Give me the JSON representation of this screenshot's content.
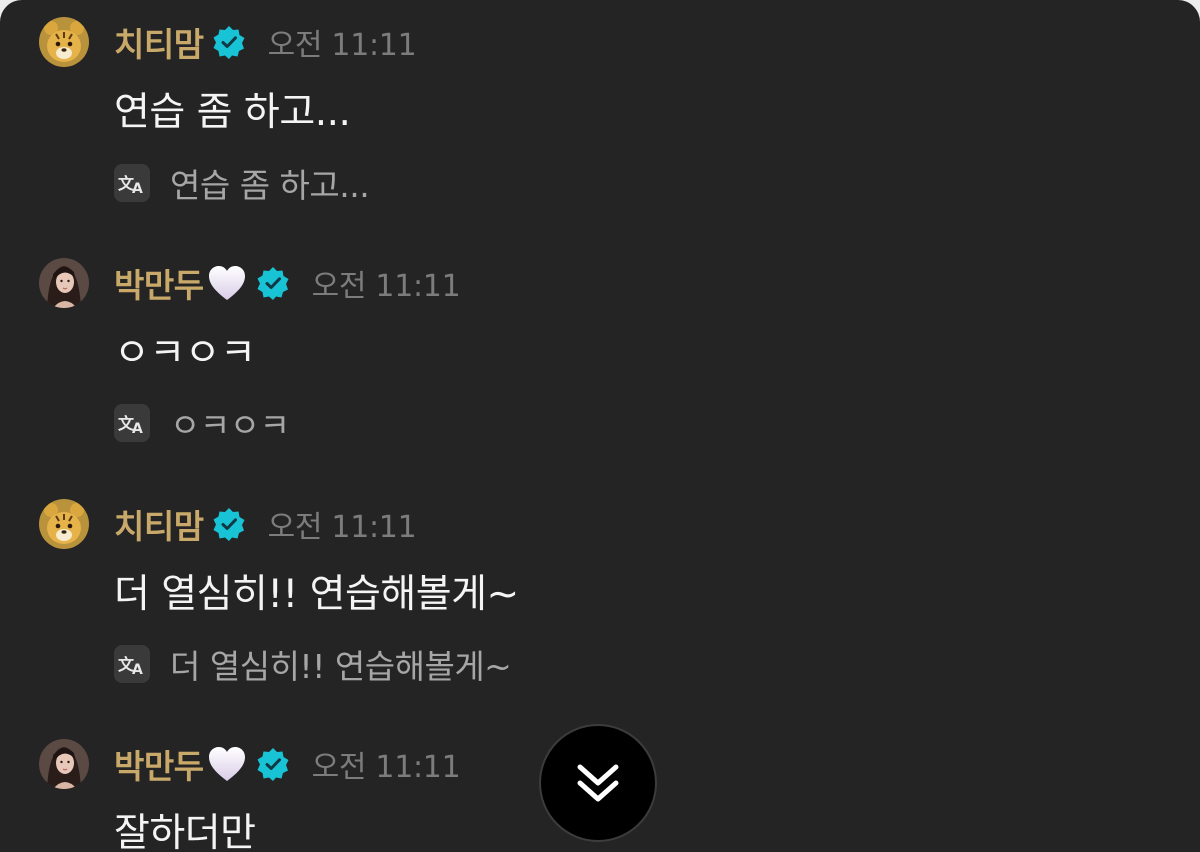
{
  "messages": [
    {
      "author": "치티맘",
      "time": "오전 11:11",
      "text": "연습 좀 하고...",
      "translation": "연습 좀 하고..."
    },
    {
      "author": "박만두",
      "time": "오전 11:11",
      "text": "ㅇㅋㅇㅋ",
      "translation": "ㅇㅋㅇㅋ"
    },
    {
      "author": "치티맘",
      "time": "오전 11:11",
      "text": "더 열심히!! 연습해볼게~",
      "translation": "더 열심히!! 연습해볼게~"
    },
    {
      "author": "박만두",
      "time": "오전 11:11",
      "text": "잘하더만"
    }
  ],
  "icons": {
    "verified": "verified-badge-icon",
    "heart": "white-heart-icon",
    "translate": "translate-icon",
    "scroll": "double-chevron-down-icon"
  },
  "colors": {
    "background": "#242424",
    "author_name": "#c9a96a",
    "timestamp": "#7c7c7c",
    "message_text": "#f4f4f4",
    "translation_text": "#a6a6a6",
    "verified_badge": "#19c3d6"
  }
}
